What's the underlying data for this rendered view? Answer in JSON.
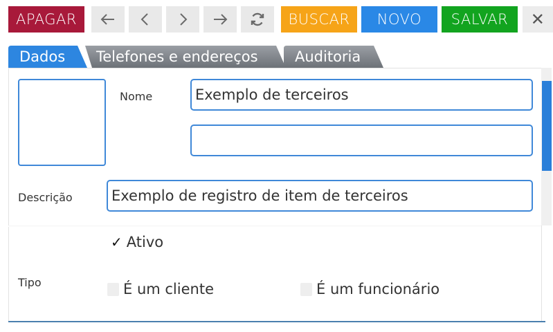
{
  "toolbar": {
    "delete_label": "APAGAR",
    "search_label": "BUSCAR",
    "new_label": "NOVO",
    "save_label": "SALVAR",
    "close_symbol": "✕",
    "colors": {
      "delete": "#a8193a",
      "search": "#f6a418",
      "new": "#2a88e6",
      "save": "#12a41f"
    }
  },
  "tabs": [
    {
      "label": "Dados",
      "active": true
    },
    {
      "label": "Telefones e endereços",
      "active": false
    },
    {
      "label": "Auditoria",
      "active": false
    }
  ],
  "form": {
    "nome_label": "Nome",
    "nome_value": "Exemplo de terceiros",
    "nome2_value": "",
    "descricao_label": "Descrição",
    "descricao_value": "Exemplo de registro de item de terceiros",
    "ativo_mark": "✓",
    "ativo_label": "Ativo",
    "tipo_label": "Tipo",
    "cliente_label": "É um cliente",
    "funcionario_label": "É um funcionário"
  },
  "icons": [
    "arrow-left-icon",
    "chevron-left-icon",
    "chevron-right-icon",
    "arrow-right-icon",
    "refresh-icon",
    "close-icon"
  ]
}
